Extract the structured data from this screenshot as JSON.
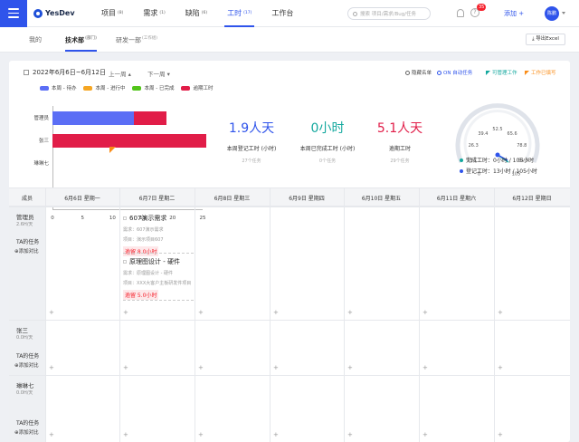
{
  "topnav": {
    "logo": "YesDev",
    "items": [
      {
        "label": "项目",
        "count": "(8)"
      },
      {
        "label": "需求",
        "count": "(1)"
      },
      {
        "label": "缺陷",
        "count": "(6)"
      },
      {
        "label": "工时",
        "count": "(17)"
      },
      {
        "label": "工作台",
        "count": ""
      }
    ],
    "search_placeholder": "搜索 项目/需求/Bug/任务",
    "badge": "35",
    "add_label": "添加 +",
    "avatar": "陈鹏",
    "accent": "#2f54eb"
  },
  "subtabs": {
    "items": [
      {
        "label": "我的",
        "count": ""
      },
      {
        "label": "技术部",
        "count": "(部门)"
      },
      {
        "label": "研发一部",
        "count": "(工作组)"
      }
    ],
    "export_label": "导出Excel"
  },
  "toolbar": {
    "date_range": "2022年6月6日~6月12日",
    "prev": "上一周 ▴",
    "next": "下一周 ▾",
    "hide_list": "隐藏名单",
    "auto_task": "ON 自动任务",
    "workable": "可管理工作",
    "filled": "工作已填写"
  },
  "legend": [
    {
      "label": "本周 - 待办",
      "color": "#5b6ef5"
    },
    {
      "label": "本周 - 进行中",
      "color": "#f5a623"
    },
    {
      "label": "本周 - 已完成",
      "color": "#52c41a"
    },
    {
      "label": "逾期工时",
      "color": "#e11d48"
    }
  ],
  "chart_data": {
    "type": "bar",
    "orientation": "horizontal",
    "categories": [
      "管理员",
      "张三",
      "琳琳七"
    ],
    "series": [
      {
        "name": "本周 - 待办",
        "values": [
          13.5,
          0,
          0
        ]
      },
      {
        "name": "逾期工时",
        "values": [
          5.5,
          26,
          0
        ]
      }
    ],
    "xticks": [
      0,
      5,
      10,
      15,
      20,
      25
    ],
    "xlim": [
      0,
      25
    ]
  },
  "stats": [
    {
      "num": "1.9人天",
      "label": "本周登记工时 (小时)",
      "sub": "27个任务",
      "color": "#2f54eb"
    },
    {
      "num": "0小时",
      "label": "本周已完成工时 (小时)",
      "sub": "0个任务",
      "color": "#13a89e"
    },
    {
      "num": "5.1人天",
      "label": "逾期工时",
      "sub": "29个任务",
      "color": "#e11d48"
    }
  ],
  "gauge": {
    "ticks": [
      "0",
      "13.1",
      "26.3",
      "39.4",
      "52.5",
      "65.6",
      "78.8",
      "91.9",
      "105"
    ],
    "done_label": "完成工时：0小时 / 105小时",
    "logged_label": "登记工时：13小时 / 105小时",
    "done_color": "#13a89e",
    "logged_color": "#2f54eb"
  },
  "grid": {
    "head_member": "成员",
    "days": [
      "6月6日 星期一",
      "6月7日 星期二",
      "6月8日 星期三",
      "6月9日 星期四",
      "6月10日 星期五",
      "6月11日 星期六",
      "6月12日 星期日"
    ],
    "members": [
      {
        "name": "管理员",
        "rate": "2.6H/天",
        "ta": "TA的任务",
        "add": "⊕添加对比"
      },
      {
        "name": "张三",
        "rate": "0.0H/天",
        "ta": "TA的任务",
        "add": "⊕添加对比"
      },
      {
        "name": "琳琳七",
        "rate": "0.0H/天",
        "ta": "TA的任务",
        "add": "⊕添加对比"
      }
    ],
    "tasks": [
      {
        "title": "607演示需求",
        "req": "需求：607演示需求",
        "proj": "项目：演示项目607",
        "overdue": "逾留 8.0小时"
      },
      {
        "title": "原理图设计 - 硬件",
        "req": "需求：原理图设计 - 硬件",
        "proj": "项目：XXX大客户主板研发件项目",
        "overdue": "逾留 5.0小时"
      }
    ]
  }
}
